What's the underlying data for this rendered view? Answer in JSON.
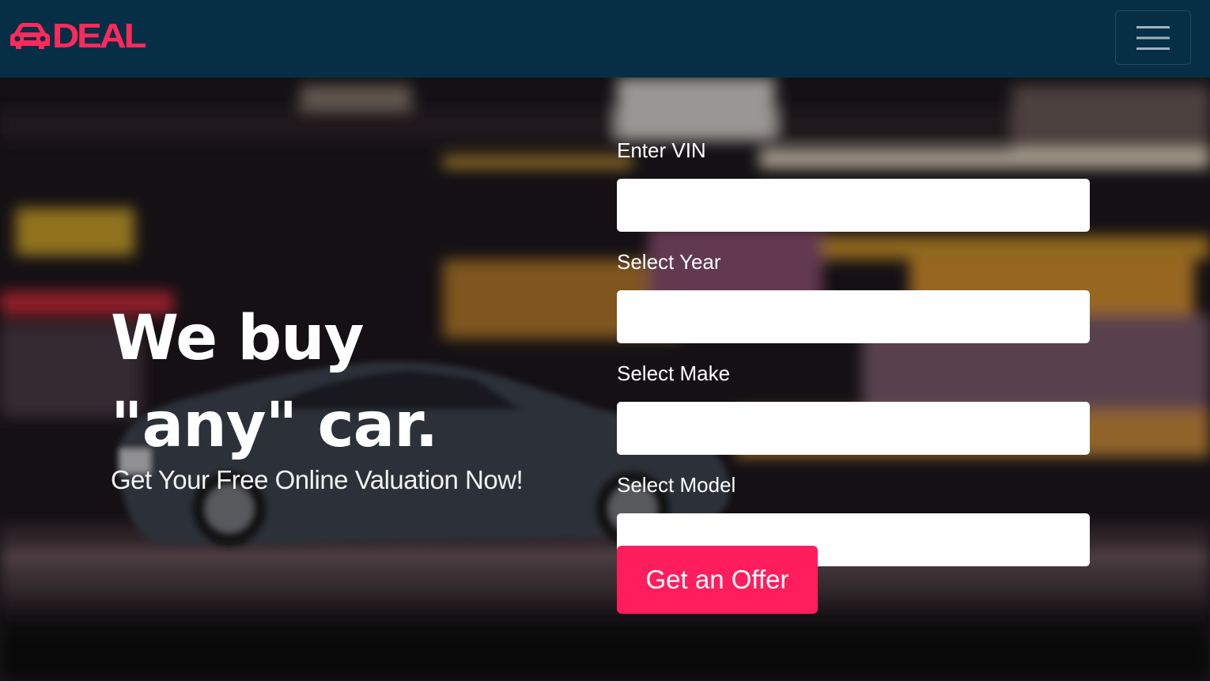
{
  "brand": {
    "name": "DEAL",
    "icon": "car-icon",
    "color": "#ff2a5b"
  },
  "navbar": {
    "background": "#062f45",
    "menu_icon": "hamburger-menu-icon"
  },
  "hero": {
    "headline": "We buy \"any\" car.",
    "subheadline": "Get Your Free Online Valuation Now!"
  },
  "form": {
    "fields": [
      {
        "label": "Enter VIN",
        "value": ""
      },
      {
        "label": "Select Year",
        "value": ""
      },
      {
        "label": "Select Make",
        "value": ""
      },
      {
        "label": "Select Model",
        "value": ""
      }
    ],
    "submit_label": "Get an Offer",
    "submit_color": "#ff1d5e"
  }
}
